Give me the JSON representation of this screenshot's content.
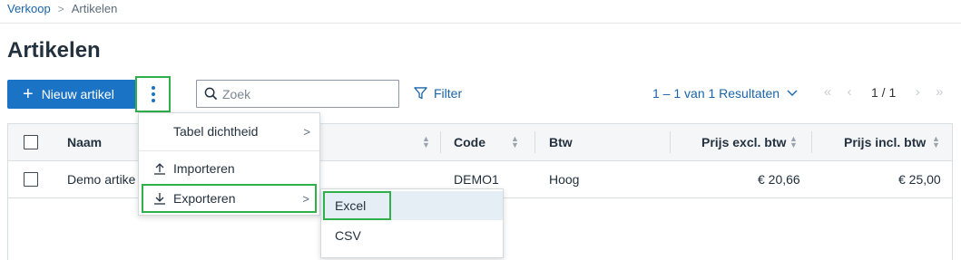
{
  "breadcrumb": {
    "parent": "Verkoop",
    "separator": ">",
    "current": "Artikelen"
  },
  "page": {
    "title": "Artikelen"
  },
  "toolbar": {
    "new_label": "Nieuw artikel",
    "search_placeholder": "Zoek",
    "filter_label": "Filter",
    "results_label": "1 – 1 van 1 Resultaten",
    "page_label": "1 / 1"
  },
  "table": {
    "headers": {
      "name": "Naam",
      "code": "Code",
      "vat": "Btw",
      "price_excl": "Prijs excl. btw",
      "price_incl": "Prijs incl. btw"
    },
    "rows": [
      {
        "name": "Demo artike",
        "code": "DEMO1",
        "vat": "Hoog",
        "price_excl": "€ 20,66",
        "price_incl": "€ 25,00"
      }
    ]
  },
  "menu": {
    "density": "Tabel dichtheid",
    "import": "Importeren",
    "export": "Exporteren"
  },
  "submenu": {
    "excel": "Excel",
    "csv": "CSV"
  },
  "colors": {
    "primary": "#1b73c6",
    "highlight": "#2fb04a",
    "link": "#1a64a8"
  },
  "icons": [
    "plus-icon",
    "kebab-icon",
    "search-icon",
    "filter-icon",
    "chevron-down-icon",
    "first-page-icon",
    "prev-page-icon",
    "next-page-icon",
    "last-page-icon",
    "upload-icon",
    "download-icon",
    "chevron-right-icon"
  ]
}
